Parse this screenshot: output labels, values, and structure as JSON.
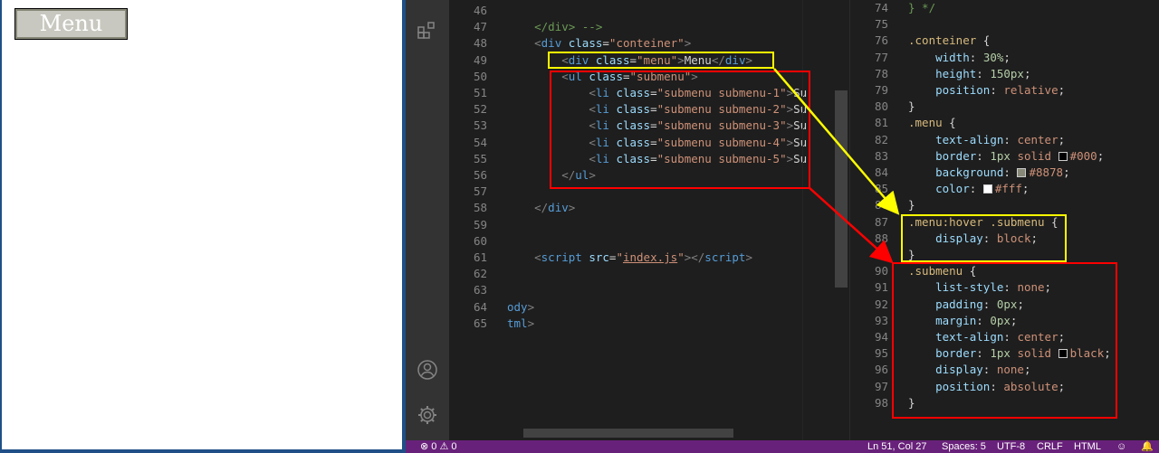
{
  "preview": {
    "menu_label": "Menu"
  },
  "editor_left": {
    "lines": [
      {
        "n": "46",
        "html": ""
      },
      {
        "n": "47",
        "html": "<span class='cmt'>    &lt;/div&gt; --&gt;</span>"
      },
      {
        "n": "48",
        "html": "    <span class='gray'>&lt;</span><span class='tag'>div</span> <span class='attr'>class</span>=<span class='str'>\"conteiner\"</span><span class='gray'>&gt;</span>"
      },
      {
        "n": "49",
        "html": "        <span class='gray'>&lt;</span><span class='tag'>div</span> <span class='attr'>class</span>=<span class='str'>\"menu\"</span><span class='gray'>&gt;</span>Menu<span class='gray'>&lt;/</span><span class='tag'>div</span><span class='gray'>&gt;</span>"
      },
      {
        "n": "50",
        "html": "        <span class='gray'>&lt;</span><span class='tag'>ul</span> <span class='attr'>class</span>=<span class='str'>\"submenu\"</span><span class='gray'>&gt;</span>"
      },
      {
        "n": "51",
        "html": "            <span class='gray'>&lt;</span><span class='tag'>li</span> <span class='attr'>class</span>=<span class='str'>\"submenu submenu-1\"</span><span class='gray'>&gt;</span>Su"
      },
      {
        "n": "52",
        "html": "            <span class='gray'>&lt;</span><span class='tag'>li</span> <span class='attr'>class</span>=<span class='str'>\"submenu submenu-2\"</span><span class='gray'>&gt;</span>Su"
      },
      {
        "n": "53",
        "html": "            <span class='gray'>&lt;</span><span class='tag'>li</span> <span class='attr'>class</span>=<span class='str'>\"submenu submenu-3\"</span><span class='gray'>&gt;</span>Su"
      },
      {
        "n": "54",
        "html": "            <span class='gray'>&lt;</span><span class='tag'>li</span> <span class='attr'>class</span>=<span class='str'>\"submenu submenu-4\"</span><span class='gray'>&gt;</span>Su"
      },
      {
        "n": "55",
        "html": "            <span class='gray'>&lt;</span><span class='tag'>li</span> <span class='attr'>class</span>=<span class='str'>\"submenu submenu-5\"</span><span class='gray'>&gt;</span>Su"
      },
      {
        "n": "56",
        "html": "        <span class='gray'>&lt;/</span><span class='tag'>ul</span><span class='gray'>&gt;</span>"
      },
      {
        "n": "57",
        "html": ""
      },
      {
        "n": "58",
        "html": "    <span class='gray'>&lt;/</span><span class='tag'>div</span><span class='gray'>&gt;</span>"
      },
      {
        "n": "59",
        "html": ""
      },
      {
        "n": "60",
        "html": ""
      },
      {
        "n": "61",
        "html": "    <span class='gray'>&lt;</span><span class='tag'>script</span> <span class='attr'>src</span>=<span class='str'>\"<u>index.js</u>\"</span><span class='gray'>&gt;&lt;/</span><span class='tag'>script</span><span class='gray'>&gt;</span>"
      },
      {
        "n": "62",
        "html": ""
      },
      {
        "n": "63",
        "html": ""
      },
      {
        "n": "64",
        "html": "<span class='tag'>ody</span><span class='gray'>&gt;</span>"
      },
      {
        "n": "65",
        "html": "<span class='tag'>tml</span><span class='gray'>&gt;</span>"
      }
    ]
  },
  "editor_right": {
    "lines": [
      {
        "n": "74",
        "html": "<span class='cmt'>} */</span>"
      },
      {
        "n": "75",
        "html": ""
      },
      {
        "n": "76",
        "html": "<span class='sel'>.conteiner</span> {"
      },
      {
        "n": "77",
        "html": "    <span class='prop'>width</span>: <span class='num'>30%</span>;"
      },
      {
        "n": "78",
        "html": "    <span class='prop'>height</span>: <span class='num'>150px</span>;"
      },
      {
        "n": "79",
        "html": "    <span class='prop'>position</span>: <span class='val'>relative</span>;"
      },
      {
        "n": "80",
        "html": "}"
      },
      {
        "n": "81",
        "html": "<span class='sel'>.menu</span> {"
      },
      {
        "n": "82",
        "html": "    <span class='prop'>text-align</span>: <span class='val'>center</span>;"
      },
      {
        "n": "83",
        "html": "    <span class='prop'>border</span>: <span class='num'>1px</span> <span class='val'>solid</span> <span class='swatch' style='background:#000'></span><span class='val'>#000</span>;"
      },
      {
        "n": "84",
        "html": "    <span class='prop'>background</span>: <span class='swatch' style='background:#888878'></span><span class='val'>#8878</span>;"
      },
      {
        "n": "85",
        "html": "    <span class='prop'>color</span>: <span class='swatch' style='background:#fff'></span><span class='val'>#fff</span>;"
      },
      {
        "n": "86",
        "html": "}"
      },
      {
        "n": "87",
        "html": "<span class='sel'>.menu:hover .submenu</span> {"
      },
      {
        "n": "88",
        "html": "    <span class='prop'>display</span>: <span class='val'>block</span>;"
      },
      {
        "n": "89",
        "html": "}"
      },
      {
        "n": "90",
        "html": "<span class='sel'>.submenu</span> {"
      },
      {
        "n": "91",
        "html": "    <span class='prop'>list-style</span>: <span class='val'>none</span>;"
      },
      {
        "n": "92",
        "html": "    <span class='prop'>padding</span>: <span class='num'>0px</span>;"
      },
      {
        "n": "93",
        "html": "    <span class='prop'>margin</span>: <span class='num'>0px</span>;"
      },
      {
        "n": "94",
        "html": "    <span class='prop'>text-align</span>: <span class='val'>center</span>;"
      },
      {
        "n": "95",
        "html": "    <span class='prop'>border</span>: <span class='num'>1px</span> <span class='val'>solid</span> <span class='swatch' style='background:#000'></span><span class='val'>black</span>;"
      },
      {
        "n": "96",
        "html": "    <span class='prop'>display</span>: <span class='val'>none</span>;"
      },
      {
        "n": "97",
        "html": "    <span class='prop'>position</span>: <span class='val'>absolute</span>;"
      },
      {
        "n": "98",
        "html": "}"
      }
    ]
  },
  "status": {
    "problems": "⊗ 0 ⚠ 0",
    "cursor": "Ln 51, Col 27",
    "spaces": "Spaces: 5",
    "encoding": "UTF-8",
    "eol": "CRLF",
    "language": "HTML"
  },
  "colors": {
    "status_bar": "#68217a",
    "annotation_yellow": "#ffff00",
    "annotation_red": "#ff0000"
  }
}
